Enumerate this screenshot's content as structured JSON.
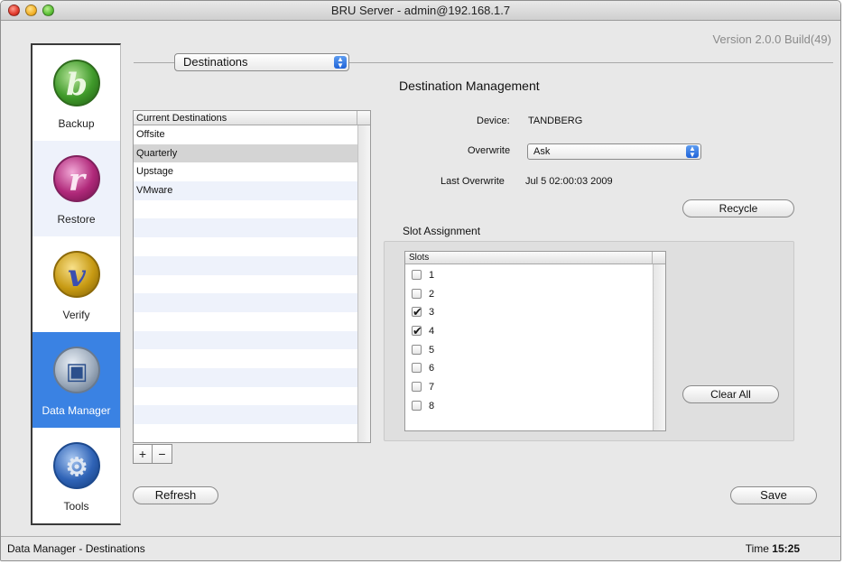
{
  "window": {
    "title": "BRU Server - admin@192.168.1.7",
    "version": "Version 2.0.0 Build(49)"
  },
  "sidebar": {
    "items": [
      {
        "label": "Backup",
        "icon": "backup-icon",
        "glyph": "b"
      },
      {
        "label": "Restore",
        "icon": "restore-icon",
        "glyph": "r"
      },
      {
        "label": "Verify",
        "icon": "verify-icon",
        "glyph": "v"
      },
      {
        "label": "Data Manager",
        "icon": "data-manager-icon",
        "glyph": "▣",
        "selected": true
      },
      {
        "label": "Tools",
        "icon": "tools-icon",
        "glyph": "⚙"
      }
    ]
  },
  "main": {
    "section_select": "Destinations",
    "heading": "Destination Management",
    "destinations": {
      "header": "Current Destinations",
      "rows": [
        "Offsite",
        "Quarterly",
        "Upstage",
        "VMware"
      ],
      "selected": "Quarterly"
    },
    "device_label": "Device:",
    "device_value": "TANDBERG",
    "overwrite_label": "Overwrite",
    "overwrite_value": "Ask",
    "last_overwrite_label": "Last Overwrite",
    "last_overwrite_value": "Jul 5 02:00:03 2009",
    "recycle_button": "Recycle",
    "slot_assignment": {
      "title": "Slot Assignment",
      "header": "Slots",
      "slots": [
        {
          "label": "1",
          "checked": false
        },
        {
          "label": "2",
          "checked": false
        },
        {
          "label": "3",
          "checked": true
        },
        {
          "label": "4",
          "checked": true
        },
        {
          "label": "5",
          "checked": false
        },
        {
          "label": "6",
          "checked": false
        },
        {
          "label": "7",
          "checked": false
        },
        {
          "label": "8",
          "checked": false
        }
      ]
    },
    "clear_all_button": "Clear All",
    "add_button": "+",
    "remove_button": "−",
    "refresh_button": "Refresh",
    "save_button": "Save"
  },
  "statusbar": {
    "left": "Data Manager - Destinations",
    "time_label": "Time",
    "time_value": "15:25"
  },
  "colors": {
    "selection": "#3a82e3",
    "accent_popup": "#1f63d8"
  }
}
